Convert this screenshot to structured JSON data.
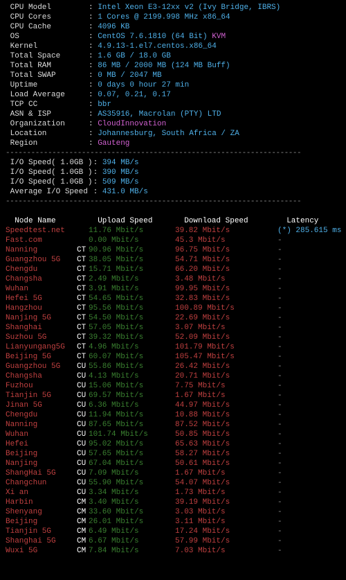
{
  "sysinfo": [
    {
      "label": "CPU Model",
      "value": "Intel Xeon E3-12xx v2 (Ivy Bridge, IBRS)"
    },
    {
      "label": "CPU Cores",
      "value": "1 Cores @ 2199.998 MHz x86_64"
    },
    {
      "label": "CPU Cache",
      "value": "4096 KB"
    },
    {
      "label": "OS",
      "value": "CentOS 7.6.1810 (64 Bit)",
      "suffix": "KVM"
    },
    {
      "label": "Kernel",
      "value": "4.9.13-1.el7.centos.x86_64"
    },
    {
      "label": "Total Space",
      "value": "1.6 GB / 18.0 GB"
    },
    {
      "label": "Total RAM",
      "value": "86 MB / 2000 MB (124 MB Buff)"
    },
    {
      "label": "Total SWAP",
      "value": "0 MB / 2047 MB"
    },
    {
      "label": "Uptime",
      "value": "0 days 0 hour 27 min"
    },
    {
      "label": "Load Average",
      "value": "0.07, 0.21, 0.17"
    },
    {
      "label": "TCP CC",
      "value": "bbr"
    },
    {
      "label": "ASN & ISP",
      "value": "AS35916, Macrolan (PTY) LTD"
    },
    {
      "label": "Organization",
      "value_alt": "CloudInnovation"
    },
    {
      "label": "Location",
      "value": "Johannesburg, South Africa / ZA"
    },
    {
      "label": "Region",
      "value_alt": "Gauteng"
    }
  ],
  "io": [
    {
      "label": "I/O Speed( 1.0GB )",
      "value": "394 MB/s"
    },
    {
      "label": "I/O Speed( 1.0GB )",
      "value": "390 MB/s"
    },
    {
      "label": "I/O Speed( 1.0GB )",
      "value": "509 MB/s"
    },
    {
      "label": "Average I/O Speed",
      "value": "431.0 MB/s"
    }
  ],
  "speed_header": {
    "node": "Node Name",
    "upload": "Upload Speed",
    "download": "Download Speed",
    "latency": "Latency"
  },
  "speedtests": [
    {
      "node": "Speedtest.net",
      "prov": "",
      "up": "11.76 Mbit/s",
      "dn": "39.82 Mbit/s",
      "lat": "(*) 285.615 ms",
      "lat_star": true
    },
    {
      "node": "Fast.com",
      "prov": "",
      "up": "0.00 Mbit/s",
      "dn": "45.3 Mbit/s",
      "lat": "-"
    },
    {
      "node": "Nanning",
      "prov": "CT",
      "up": "90.96 Mbit/s",
      "dn": "96.75 Mbit/s",
      "lat": "-"
    },
    {
      "node": "Guangzhou 5G",
      "prov": "CT",
      "up": "38.05 Mbit/s",
      "dn": "54.71 Mbit/s",
      "lat": "-"
    },
    {
      "node": "Chengdu",
      "prov": "CT",
      "up": "15.71 Mbit/s",
      "dn": "66.20 Mbit/s",
      "lat": "-"
    },
    {
      "node": "Changsha",
      "prov": "CT",
      "up": "2.49 Mbit/s",
      "dn": "3.48 Mbit/s",
      "lat": "-"
    },
    {
      "node": "Wuhan",
      "prov": "CT",
      "up": "3.91 Mbit/s",
      "dn": "99.95 Mbit/s",
      "lat": "-"
    },
    {
      "node": "Hefei 5G",
      "prov": "CT",
      "up": "54.65 Mbit/s",
      "dn": "32.83 Mbit/s",
      "lat": "-"
    },
    {
      "node": "Hangzhou",
      "prov": "CT",
      "up": "95.56 Mbit/s",
      "dn": "100.89 Mbit/s",
      "lat": "-"
    },
    {
      "node": "Nanjing 5G",
      "prov": "CT",
      "up": "54.50 Mbit/s",
      "dn": "22.69 Mbit/s",
      "lat": "-"
    },
    {
      "node": "Shanghai",
      "prov": "CT",
      "up": "57.05 Mbit/s",
      "dn": "3.07 Mbit/s",
      "lat": "-"
    },
    {
      "node": "Suzhou 5G",
      "prov": "CT",
      "up": "39.32 Mbit/s",
      "dn": "52.09 Mbit/s",
      "lat": "-"
    },
    {
      "node": "Lianyungang5G",
      "prov": "CT",
      "up": "4.96 Mbit/s",
      "dn": "101.79 Mbit/s",
      "lat": "-"
    },
    {
      "node": "Beijing 5G",
      "prov": "CT",
      "up": "60.07 Mbit/s",
      "dn": "105.47 Mbit/s",
      "lat": "-"
    },
    {
      "node": "Guangzhou 5G",
      "prov": "CU",
      "up": "55.86 Mbit/s",
      "dn": "26.42 Mbit/s",
      "lat": "-"
    },
    {
      "node": "Changsha",
      "prov": "CU",
      "up": "4.13 Mbit/s",
      "dn": "20.71 Mbit/s",
      "lat": "-"
    },
    {
      "node": "Fuzhou",
      "prov": "CU",
      "up": "15.06 Mbit/s",
      "dn": "7.75 Mbit/s",
      "lat": "-"
    },
    {
      "node": "Tianjin 5G",
      "prov": "CU",
      "up": "69.57 Mbit/s",
      "dn": "1.67 Mbit/s",
      "lat": "-"
    },
    {
      "node": "Jinan 5G",
      "prov": "CU",
      "up": "6.36 Mbit/s",
      "dn": "44.97 Mbit/s",
      "lat": "-"
    },
    {
      "node": "Chengdu",
      "prov": "CU",
      "up": "11.94 Mbit/s",
      "dn": "10.88 Mbit/s",
      "lat": "-"
    },
    {
      "node": "Nanning",
      "prov": "CU",
      "up": "87.65 Mbit/s",
      "dn": "87.52 Mbit/s",
      "lat": "-"
    },
    {
      "node": "Wuhan",
      "prov": "CU",
      "up": "101.74 Mbit/s",
      "dn": "50.85 Mbit/s",
      "lat": "-"
    },
    {
      "node": "Hefei",
      "prov": "CU",
      "up": "95.02 Mbit/s",
      "dn": "65.63 Mbit/s",
      "lat": "-"
    },
    {
      "node": "Beijing",
      "prov": "CU",
      "up": "57.65 Mbit/s",
      "dn": "58.27 Mbit/s",
      "lat": "-"
    },
    {
      "node": "Nanjing",
      "prov": "CU",
      "up": "67.04 Mbit/s",
      "dn": "50.61 Mbit/s",
      "lat": "-"
    },
    {
      "node": "ShangHai 5G",
      "prov": "CU",
      "up": "7.09 Mbit/s",
      "dn": "1.67 Mbit/s",
      "lat": "-"
    },
    {
      "node": "Changchun",
      "prov": "CU",
      "up": "55.90 Mbit/s",
      "dn": "54.07 Mbit/s",
      "lat": "-"
    },
    {
      "node": "Xi an",
      "prov": "CU",
      "up": "3.34 Mbit/s",
      "dn": "1.73 Mbit/s",
      "lat": "-"
    },
    {
      "node": "Harbin",
      "prov": "CM",
      "up": "3.40 Mbit/s",
      "dn": "39.19 Mbit/s",
      "lat": "-"
    },
    {
      "node": "Shenyang",
      "prov": "CM",
      "up": "33.60 Mbit/s",
      "dn": "3.03 Mbit/s",
      "lat": "-"
    },
    {
      "node": "Beijing",
      "prov": "CM",
      "up": "26.01 Mbit/s",
      "dn": "3.11 Mbit/s",
      "lat": "-"
    },
    {
      "node": "Tianjin 5G",
      "prov": "CM",
      "up": "6.49 Mbit/s",
      "dn": "17.24 Mbit/s",
      "lat": "-"
    },
    {
      "node": "Shanghai 5G",
      "prov": "CM",
      "up": "6.67 Mbit/s",
      "dn": "57.99 Mbit/s",
      "lat": "-"
    },
    {
      "node": "Wuxi 5G",
      "prov": "CM",
      "up": "7.84 Mbit/s",
      "dn": "7.03 Mbit/s",
      "lat": "-"
    }
  ]
}
